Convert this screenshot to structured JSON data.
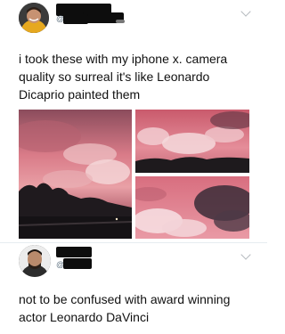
{
  "tweets": [
    {
      "text": "i took these with my iphone x. camera quality so surreal it's like Leonardo Dicaprio painted them",
      "handle_prefix": "@",
      "photos": [
        {
          "description": "pink sunset sky over trees and road"
        },
        {
          "description": "pink clouds over dark hills"
        },
        {
          "description": "pink cumulus clouds and dark storm cloud"
        }
      ],
      "icons": {
        "menu": "chevron-down-icon"
      }
    },
    {
      "text": "not to be confused with award winning actor Leonardo DaVinci",
      "handle_prefix": "@",
      "icons": {
        "menu": "chevron-down-icon"
      }
    }
  ],
  "colors": {
    "sky_pink": "#e8899a",
    "cloud_light": "#f3d6da",
    "dark_land": "#1c1a1e",
    "divider": "#e6ecf0"
  }
}
